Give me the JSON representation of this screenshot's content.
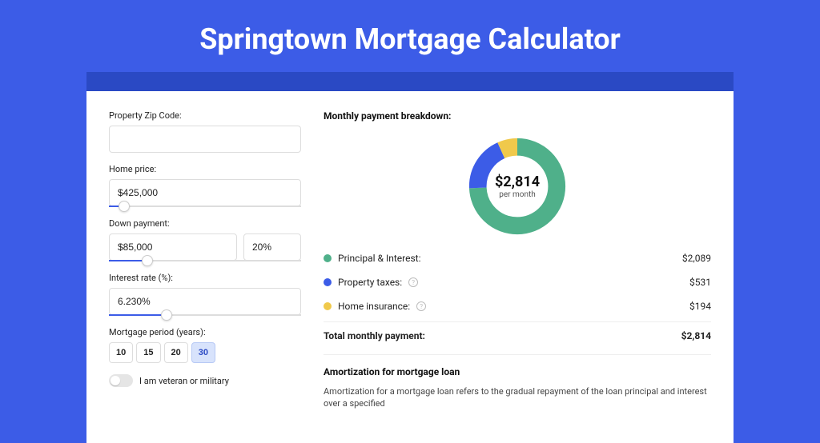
{
  "page_title": "Springtown Mortgage Calculator",
  "form": {
    "zip_label": "Property Zip Code:",
    "zip_value": "",
    "home_price_label": "Home price:",
    "home_price_value": "$425,000",
    "home_price_slider_pct": 8,
    "down_payment_label": "Down payment:",
    "down_payment_value": "$85,000",
    "down_payment_pct_value": "20%",
    "down_payment_slider_pct": 20,
    "interest_label": "Interest rate (%):",
    "interest_value": "6.230%",
    "interest_slider_pct": 30,
    "period_label": "Mortgage period (years):",
    "period_options": [
      "10",
      "15",
      "20",
      "30"
    ],
    "period_active_index": 3,
    "veteran_label": "I am veteran or military",
    "veteran_on": false
  },
  "breakdown": {
    "title": "Monthly payment breakdown:",
    "center_amount": "$2,814",
    "center_sub": "per month",
    "items": [
      {
        "label": "Principal & Interest:",
        "amount": "$2,089",
        "color": "green",
        "info": false
      },
      {
        "label": "Property taxes:",
        "amount": "$531",
        "color": "blue",
        "info": true
      },
      {
        "label": "Home insurance:",
        "amount": "$194",
        "color": "yellow",
        "info": true
      }
    ],
    "total_label": "Total monthly payment:",
    "total_amount": "$2,814"
  },
  "amortization": {
    "title": "Amortization for mortgage loan",
    "body": "Amortization for a mortgage loan refers to the gradual repayment of the loan principal and interest over a specified"
  },
  "chart_data": {
    "type": "pie",
    "title": "Monthly payment breakdown",
    "series": [
      {
        "name": "Principal & Interest",
        "value": 2089,
        "color": "#4fb08a"
      },
      {
        "name": "Property taxes",
        "value": 531,
        "color": "#3c5ce7"
      },
      {
        "name": "Home insurance",
        "value": 194,
        "color": "#f0c94b"
      }
    ],
    "total": 2814,
    "center_label": "$2,814 per month"
  }
}
